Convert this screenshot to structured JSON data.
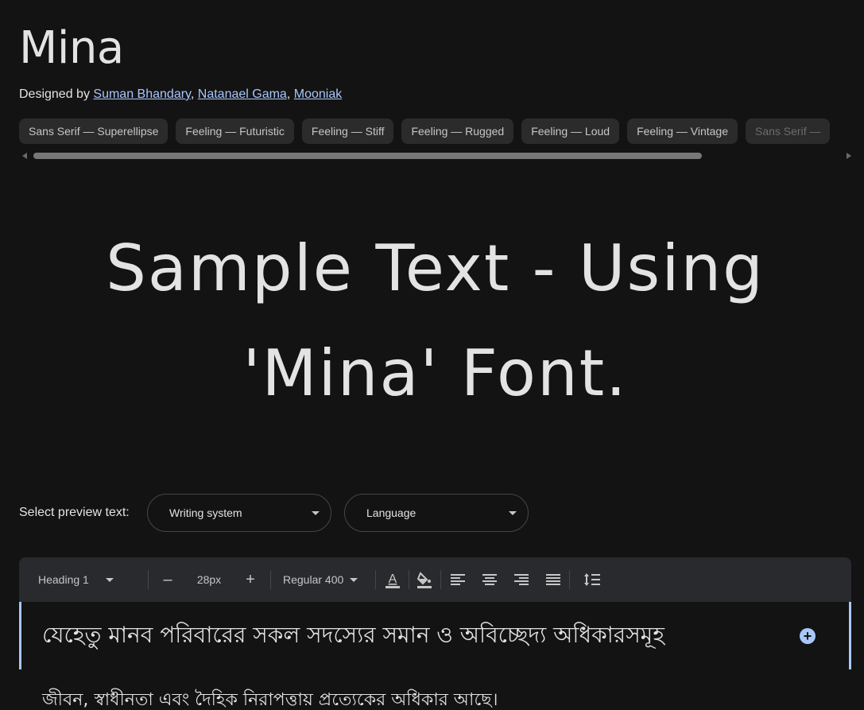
{
  "font": {
    "name": "Mina",
    "designed_by_prefix": "Designed by",
    "designers": [
      "Suman Bhandary",
      "Natanael Gama",
      "Mooniak"
    ],
    "separator": ","
  },
  "tags": [
    "Sans Serif — Superellipse",
    "Feeling — Futuristic",
    "Feeling — Stiff",
    "Feeling — Rugged",
    "Feeling — Loud",
    "Feeling — Vintage",
    "Sans Serif —"
  ],
  "preview": {
    "sample_text": "Sample Text - Using 'Mina' Font."
  },
  "select_preview": {
    "label": "Select preview text:",
    "writing_system": "Writing system",
    "language": "Language"
  },
  "toolbar": {
    "style": "Heading 1",
    "decrease": "–",
    "size": "28px",
    "increase": "+",
    "weight": "Regular 400",
    "icons": [
      "text-color-icon",
      "highlight-icon",
      "align-left-icon",
      "align-center-icon",
      "align-right-icon",
      "align-justify-icon",
      "line-height-icon"
    ]
  },
  "editor": {
    "line1": "যেহেতু মানব পরিবারের সকল সদস্যের সমান ও অবিচ্ছেদ্য অধিকারসমূহ",
    "line2": "জীবন, স্বাধীনতা এবং দৈহিক নিরাপত্তায় প্রত্যেকের অধিকার আছে।"
  },
  "colors": {
    "background": "#131313",
    "link": "#a8c7fa",
    "accent": "#a8c7fa",
    "chip_bg": "#2b2b2b",
    "toolbar_bg": "#292a2d"
  }
}
